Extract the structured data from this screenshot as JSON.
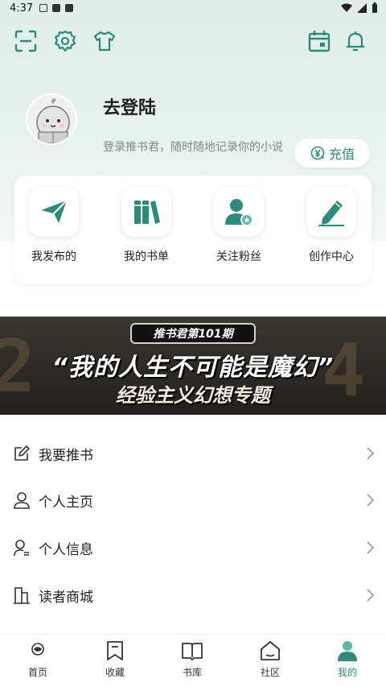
{
  "status_bar": {
    "time": "4:37"
  },
  "colors": {
    "accent": "#2b8c7a",
    "accent_light": "#5fb9a2",
    "text": "#222222"
  },
  "toolbar": {
    "left_icons": [
      "scan-icon",
      "settings-icon",
      "shirt-icon"
    ],
    "right_icons": [
      "calendar-icon",
      "bell-icon"
    ]
  },
  "profile": {
    "title": "去登陆",
    "subtitle": "登录推书君，随时随地记录你的小说",
    "recharge_label": "充值"
  },
  "quick_actions": [
    {
      "label": "我发布的",
      "icon": "send-icon"
    },
    {
      "label": "我的书单",
      "icon": "books-icon"
    },
    {
      "label": "关注粉丝",
      "icon": "user-follow-icon"
    },
    {
      "label": "创作中心",
      "icon": "pen-icon"
    }
  ],
  "banner": {
    "tag": "推书君第101期",
    "title": "“我的人生不可能是魔幻”",
    "subtitle": "经验主义幻想专题"
  },
  "menu": [
    {
      "label": "我要推书",
      "icon": "edit-note-icon"
    },
    {
      "label": "个人主页",
      "icon": "person-icon"
    },
    {
      "label": "个人信息",
      "icon": "person-info-icon"
    },
    {
      "label": "读者商城",
      "icon": "building-icon"
    }
  ],
  "bottom_nav": [
    {
      "label": "首页",
      "icon": "home-icon",
      "active": false
    },
    {
      "label": "收藏",
      "icon": "bookmark-icon",
      "active": false
    },
    {
      "label": "书库",
      "icon": "open-book-icon",
      "active": false
    },
    {
      "label": "社区",
      "icon": "community-icon",
      "active": false
    },
    {
      "label": "我的",
      "icon": "profile-icon",
      "active": true
    }
  ]
}
